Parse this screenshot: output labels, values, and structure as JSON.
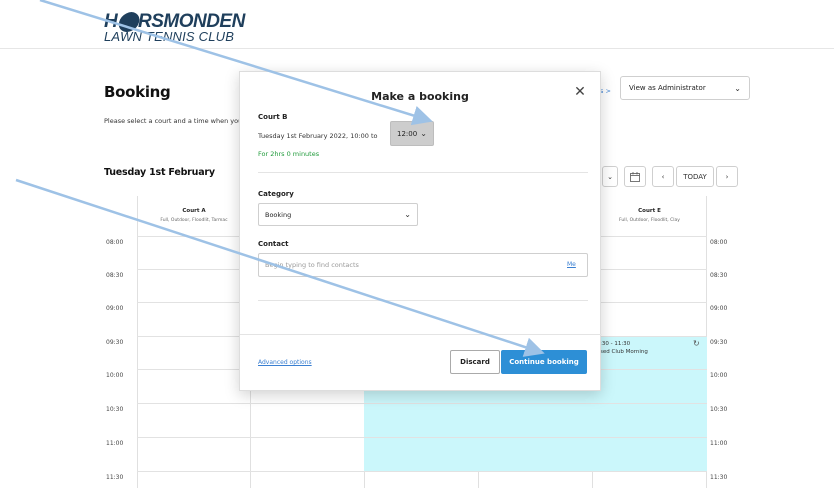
{
  "header": {
    "logo_top": "H⬤RSMONDEN",
    "logo_bottom": "LAWN TENNIS CLUB"
  },
  "page": {
    "title": "Booking",
    "subtitle": "Please select a court and a time when you",
    "lead_right_fragment": "s >",
    "view_as": "View as Administrator"
  },
  "calendar": {
    "date_title": "Tuesday 1st February",
    "today_label": "TODAY",
    "courts": [
      {
        "name": "Court A",
        "desc": "Full, Outdoor, Floodlit, Tarmac"
      },
      {
        "name": "Court E",
        "desc": "Full, Outdoor, Floodlit, Clay"
      }
    ],
    "times": [
      "08:00",
      "08:30",
      "09:00",
      "09:30",
      "10:00",
      "10:30",
      "11:00",
      "11:30"
    ],
    "booking": {
      "time": ":30 - 11:30",
      "title": "sed Club Morning"
    }
  },
  "modal": {
    "title": "Make a booking",
    "court": "Court B",
    "datetime": "Tuesday 1st February 2022, 10:00 to",
    "end_time": "12:00",
    "duration": "For 2hrs 0 minutes",
    "category_label": "Category",
    "category_value": "Booking",
    "contact_label": "Contact",
    "contact_placeholder": "Begin typing to find contacts",
    "me_link": "Me",
    "advanced_options": "Advanced options",
    "discard": "Discard",
    "continue": "Continue booking"
  },
  "colors": {
    "accent": "#2d8fd6",
    "booked": "#cbf7fb",
    "duration_green": "#1f9a3a",
    "link": "#3a7fd1",
    "arrow": "#9ec2e6"
  }
}
